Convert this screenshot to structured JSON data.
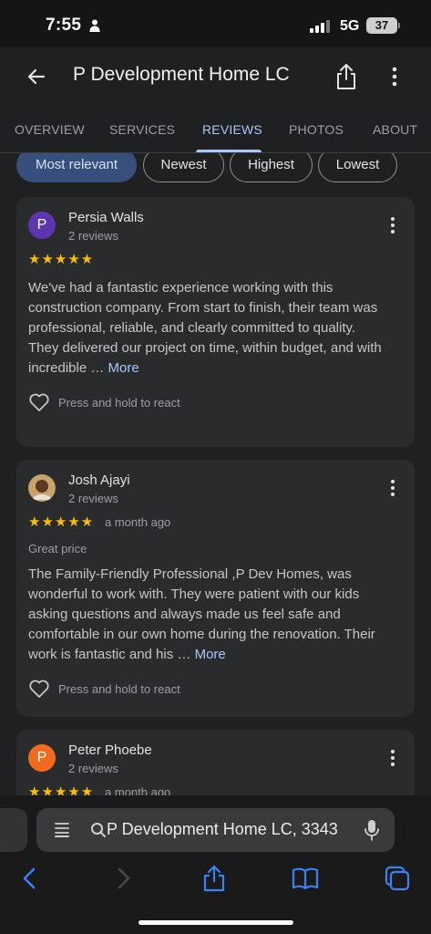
{
  "status": {
    "time": "7:55",
    "network": "5G",
    "battery": "37"
  },
  "header": {
    "title": "P Development Home LC"
  },
  "tabs": [
    {
      "label": "OVERVIEW"
    },
    {
      "label": "SERVICES"
    },
    {
      "label": "REVIEWS"
    },
    {
      "label": "PHOTOS"
    },
    {
      "label": "ABOUT"
    }
  ],
  "active_tab": "REVIEWS",
  "filters": [
    {
      "label": "Most relevant"
    },
    {
      "label": "Newest"
    },
    {
      "label": "Highest"
    },
    {
      "label": "Lowest"
    }
  ],
  "selected_filter": "Most relevant",
  "reviews": [
    {
      "initial": "P",
      "avatar_color": "#5e35b1",
      "name": "Persia Walls",
      "count": "2 reviews",
      "rating": 5,
      "stars": "★★★★★",
      "time_ago": "",
      "tagline": "",
      "text_lines": [
        "We've had a fantastic experience working with this",
        "construction company. From start to finish, their team was",
        "professional, reliable, and clearly committed to quality.",
        "They delivered our project on time, within budget, and with"
      ],
      "last_line": "incredible …",
      "more": "More",
      "react": "Press and hold to react"
    },
    {
      "initial": "",
      "avatar_color": "#c9a46a",
      "name": "Josh Ajayi",
      "count": "2 reviews",
      "rating": 5,
      "stars": "★★★★★",
      "time_ago": "a month ago",
      "tagline": "Great price",
      "text_lines": [
        "The Family-Friendly Professional ,P Dev Homes, was",
        "wonderful to work with. They were patient with our kids",
        "asking questions and always made us feel safe and",
        "comfortable in our own home during the renovation. Their"
      ],
      "last_line": "work is fantastic and his …",
      "more": "More",
      "react": "Press and hold to react"
    },
    {
      "initial": "P",
      "avatar_color": "#f26a1b",
      "name": "Peter Phoebe",
      "count": "2 reviews",
      "rating": 5,
      "stars": "★★★★★",
      "time_ago": "a month ago"
    }
  ],
  "browser": {
    "url": "P Development Home LC, 3343"
  },
  "colors": {
    "accent": "#a8c7fa",
    "star": "#fbbc04",
    "chip_selected": "#374f7a"
  },
  "icons": [
    "back-arrow-icon",
    "share-icon",
    "more-vert-icon",
    "heart-icon",
    "reader-icon",
    "search-icon",
    "mic-icon",
    "safari-back-icon",
    "safari-forward-icon",
    "safari-share-icon",
    "bookmarks-icon",
    "tabs-icon"
  ]
}
